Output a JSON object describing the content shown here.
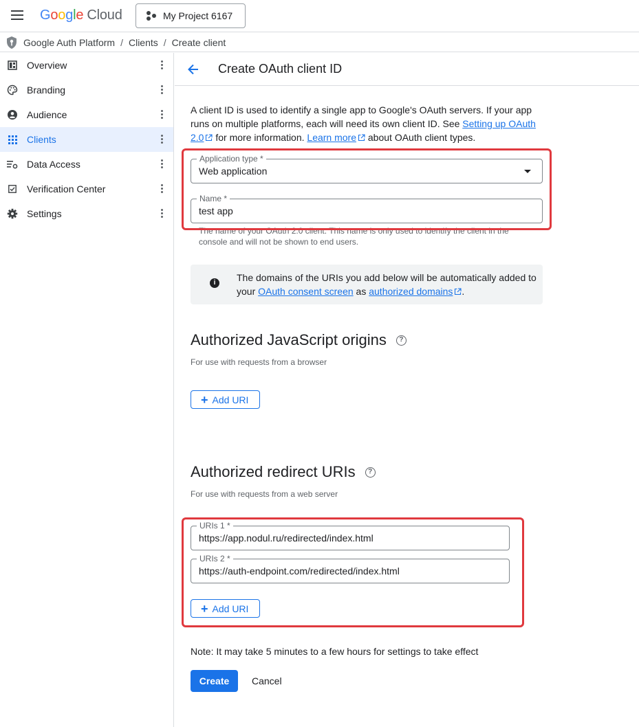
{
  "topbar": {
    "logo_letters": [
      "G",
      "o",
      "o",
      "g",
      "l",
      "e"
    ],
    "logo_product": "Cloud",
    "project": "My Project 6167"
  },
  "breadcrumb": [
    "Google Auth Platform",
    "Clients",
    "Create client"
  ],
  "sidebar": {
    "items": [
      {
        "label": "Overview",
        "icon": "dashboard-icon",
        "active": false
      },
      {
        "label": "Branding",
        "icon": "palette-icon",
        "active": false
      },
      {
        "label": "Audience",
        "icon": "person-icon",
        "active": false
      },
      {
        "label": "Clients",
        "icon": "apps-grid-icon",
        "active": true
      },
      {
        "label": "Data Access",
        "icon": "data-settings-icon",
        "active": false
      },
      {
        "label": "Verification Center",
        "icon": "checkbox-icon",
        "active": false
      },
      {
        "label": "Settings",
        "icon": "gear-icon",
        "active": false
      }
    ]
  },
  "page": {
    "title": "Create OAuth client ID",
    "intro_1": "A client ID is used to identify a single app to Google's OAuth servers. If your app runs on multiple platforms, each will need its own client ID. See ",
    "intro_link1": "Setting up OAuth 2.0",
    "intro_2": " for more information. ",
    "intro_link2": "Learn more",
    "intro_3": " about OAuth client types."
  },
  "form": {
    "app_type_label": "Application type *",
    "app_type_value": "Web application",
    "name_label": "Name *",
    "name_value": "test app",
    "name_helper": "The name of your OAuth 2.0 client. This name is only used to identify the client in the console and will not be shown to end users."
  },
  "info": {
    "text_1": "The domains of the URIs you add below will be automatically added to your ",
    "link_1": "OAuth consent screen",
    "text_2": " as ",
    "link_2": "authorized domains",
    "text_3": "."
  },
  "js_origins": {
    "title": "Authorized JavaScript origins",
    "subtitle": "For use with requests from a browser",
    "add_label": "Add URI"
  },
  "redirects": {
    "title": "Authorized redirect URIs",
    "subtitle": "For use with requests from a web server",
    "uris": [
      {
        "label": "URIs 1 *",
        "value": "https://app.nodul.ru/redirected/index.html"
      },
      {
        "label": "URIs 2 *",
        "value": "https://auth-endpoint.com/redirected/index.html"
      }
    ],
    "add_label": "Add URI"
  },
  "footer": {
    "note": "Note: It may take 5 minutes to a few hours for settings to take effect",
    "create_label": "Create",
    "cancel_label": "Cancel"
  },
  "colors": {
    "accent": "#1a73e8",
    "highlight": "#e0393e",
    "active_bg": "#e8f0fe"
  }
}
